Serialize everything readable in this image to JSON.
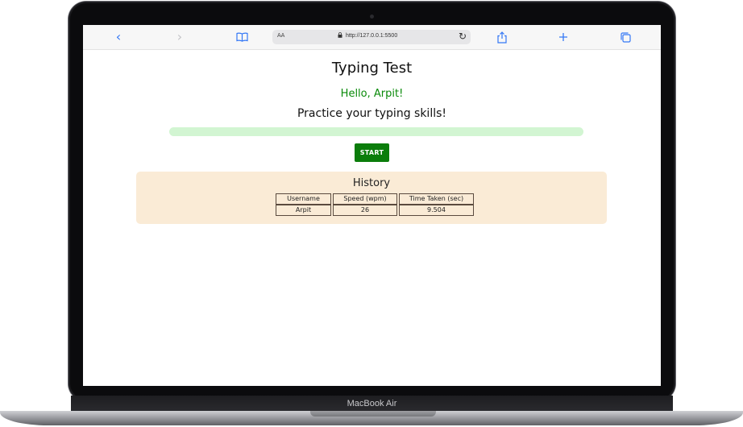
{
  "device": {
    "model_label": "MacBook Air"
  },
  "browser": {
    "text_size_label": "AA",
    "url": "http://127.0.0.1:5500",
    "icons": [
      "back-icon",
      "forward-icon",
      "bookmarks-icon",
      "lock-icon",
      "reload-icon",
      "share-icon",
      "new-tab-icon",
      "tabs-icon"
    ]
  },
  "page": {
    "title": "Typing Test",
    "greeting": "Hello, Arpit!",
    "subtitle": "Practice your typing skills!",
    "progress": 0,
    "start_label": "START",
    "colors": {
      "greeting": "#0a8a0a",
      "button": "#0b7d0b",
      "progress_track": "#d2f5d2",
      "history_bg": "#faebd6"
    }
  },
  "history": {
    "title": "History",
    "columns": [
      "Username",
      "Speed (wpm)",
      "Time Taken (sec)"
    ],
    "rows": [
      [
        "Arpit",
        "26",
        "9.504"
      ]
    ]
  }
}
